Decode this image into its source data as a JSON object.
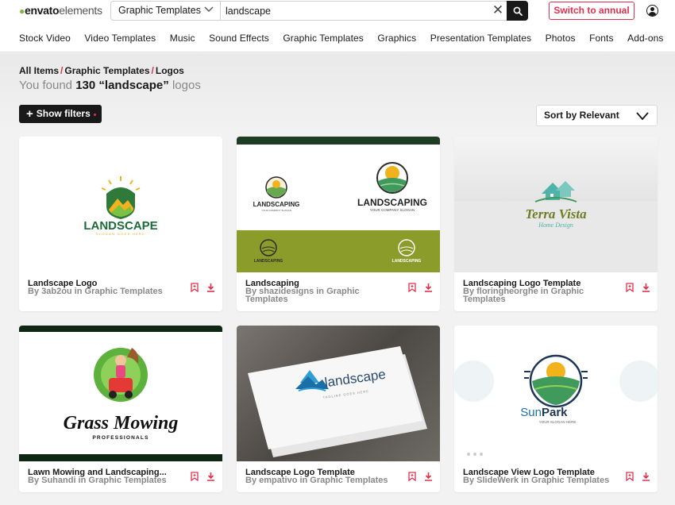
{
  "brand": {
    "name_bold": "envato",
    "name_light": "elements",
    "leaf": "●"
  },
  "search": {
    "category": "Graphic Templates",
    "query": "landscape",
    "clear_glyph": "✕"
  },
  "header": {
    "annual_label": "Switch to annual"
  },
  "nav": [
    "Stock Video",
    "Video Templates",
    "Music",
    "Sound Effects",
    "Graphic Templates",
    "Graphics",
    "Presentation Templates",
    "Photos",
    "Fonts",
    "Add-ons"
  ],
  "breadcrumb": {
    "items": [
      "All Items",
      "Graphic Templates",
      "Logos"
    ],
    "separator": "/"
  },
  "results": {
    "prefix": "You found",
    "count": "130",
    "term": "“landscape”",
    "suffix": "logos"
  },
  "filters": {
    "label": "Show filters"
  },
  "sort": {
    "label": "Sort by Relevant"
  },
  "cards": [
    {
      "title": "Landscape Logo",
      "meta": "By 3ab2ou in Graphic Templates",
      "thumb_text": {
        "main": "LANDSCAPE",
        "sub": "SLOGAN GOES HERE"
      }
    },
    {
      "title": "Landscaping",
      "meta": "By shazidesigns in Graphic Templates",
      "thumb_text": {
        "main": "LANDSCAPING",
        "sub": "YOUR COMPANY SLOGAN"
      }
    },
    {
      "title": "Landscaping Logo Template",
      "meta": "By floringheorghe in Graphic Templates",
      "thumb_text": {
        "main": "Terra Vista",
        "sub": "Home Design"
      }
    },
    {
      "title": "Lawn Mowing and Landscaping...",
      "meta": "By Suhandi in Graphic Templates",
      "thumb_text": {
        "main": "Grass Mowing",
        "sub": "PROFESSIONALS"
      }
    },
    {
      "title": "Landscape Logo Template",
      "meta": "By empativo in Graphic Templates",
      "thumb_text": {
        "main": "landscape",
        "sub": "TAGLINE GOES HERE"
      }
    },
    {
      "title": "Landscape View Logo Template",
      "meta": "By SlideWerk in Graphic Templates",
      "thumb_text": {
        "main_a": "Sun",
        "main_b": "Park",
        "sub": "YOUR SLOGAN HERE"
      }
    }
  ],
  "colors": {
    "accent": "#e0304d",
    "dark": "#191919",
    "brand_green": "#82b541"
  }
}
